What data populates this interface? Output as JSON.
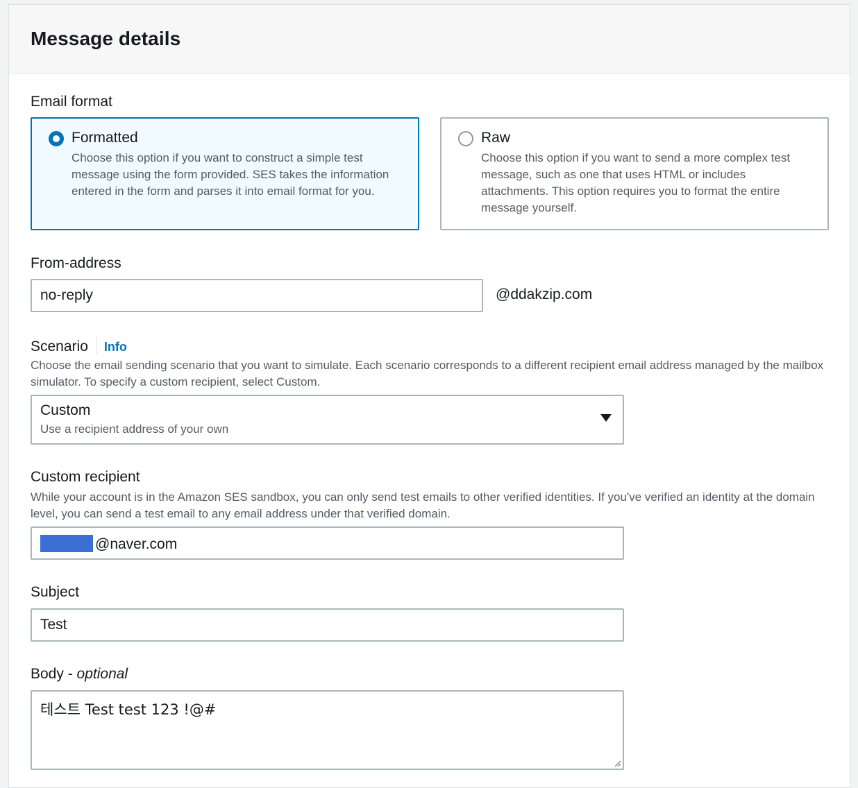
{
  "panel": {
    "title": "Message details"
  },
  "email_format": {
    "label": "Email format",
    "options": [
      {
        "title": "Formatted",
        "description": "Choose this option if you want to construct a simple test message using the form provided. SES takes the information entered in the form and parses it into email format for you.",
        "selected": true
      },
      {
        "title": "Raw",
        "description": "Choose this option if you want to send a more complex test message, such as one that uses HTML or includes attachments. This option requires you to format the entire message yourself.",
        "selected": false
      }
    ]
  },
  "from_address": {
    "label": "From-address",
    "value": "no-reply",
    "domain_suffix": "@ddakzip.com"
  },
  "scenario": {
    "label": "Scenario",
    "info_link": "Info",
    "description": "Choose the email sending scenario that you want to simulate. Each scenario corresponds to a different recipient email address managed by the mailbox simulator. To specify a custom recipient, select Custom.",
    "selected_value": "Custom",
    "selected_description": "Use a recipient address of your own"
  },
  "custom_recipient": {
    "label": "Custom recipient",
    "description": "While your account is in the Amazon SES sandbox, you can only send test emails to other verified identities. If you've verified an identity at the domain level, you can send a test email to any email address under that verified domain.",
    "value_visible": "@naver.com"
  },
  "subject": {
    "label": "Subject",
    "value": "Test"
  },
  "body": {
    "label": "Body - ",
    "label_optional": "optional",
    "value": "테스트 Test test 123 !@#"
  },
  "colors": {
    "accent": "#0073bb",
    "selected_tile_bg": "#f1faff",
    "border": "#aab7b8",
    "redaction": "#3b6fd4"
  }
}
